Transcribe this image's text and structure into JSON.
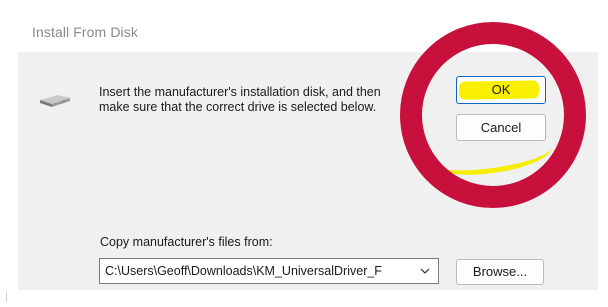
{
  "window": {
    "title": "Install From Disk"
  },
  "instruction": {
    "text": "Insert the manufacturer's installation disk, and then\nmake sure that the correct drive is selected below."
  },
  "buttons": {
    "ok": "OK",
    "cancel": "Cancel",
    "browse": "Browse..."
  },
  "copy_from": {
    "label": "Copy manufacturer's files from:",
    "path": "C:\\Users\\Geoff\\Downloads\\KM_UniversalDriver_F"
  },
  "icons": {
    "disk": "disk-drive-icon",
    "combo_arrow": "chevron-down-icon"
  },
  "colors": {
    "highlight_ring": "#c8103c",
    "highlight_marker": "#f8f000",
    "focus_border": "#0a67c2"
  }
}
